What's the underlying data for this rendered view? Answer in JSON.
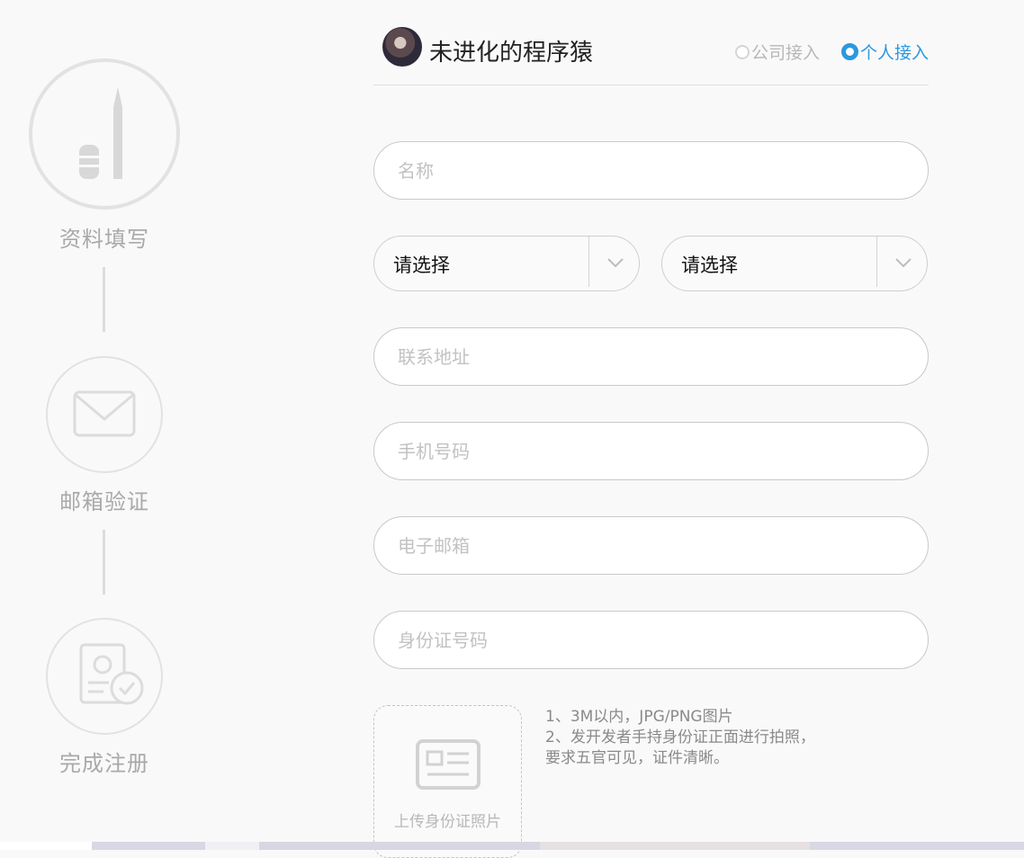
{
  "steps": [
    {
      "label": "资料填写",
      "icon": "pencil-icon"
    },
    {
      "label": "邮箱验证",
      "icon": "envelope-icon"
    },
    {
      "label": "完成注册",
      "icon": "id-check-icon"
    }
  ],
  "header": {
    "username": "未进化的程序猿",
    "radio_company": "公司接入",
    "radio_personal": "个人接入",
    "selected": "个人接入"
  },
  "form": {
    "name_placeholder": "名称",
    "select1": "请选择",
    "select2": "请选择",
    "address_placeholder": "联系地址",
    "phone_placeholder": "手机号码",
    "email_placeholder": "电子邮箱",
    "idcard_placeholder": "身份证号码"
  },
  "upload": {
    "caption": "上传身份证照片",
    "note1": "1、3M以内，JPG/PNG图片",
    "note2": "2、发开发者手持身份证正面进行拍照，",
    "note3": "要求五官可见，证件清晰。"
  },
  "colors": {
    "accent": "#2c98e0",
    "step_gray": "#e2e2e2"
  }
}
